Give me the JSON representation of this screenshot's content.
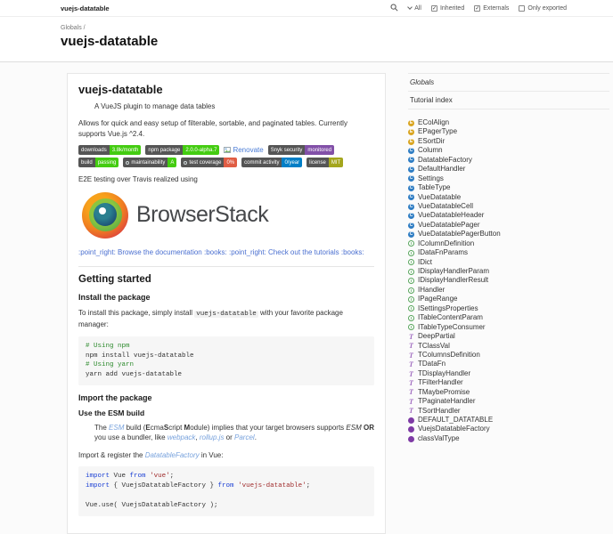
{
  "toolbar": {
    "title": "vuejs-datatable",
    "filter_all": "All",
    "checkboxes": [
      {
        "label": "Inherited",
        "checked": true
      },
      {
        "label": "Externals",
        "checked": true
      },
      {
        "label": "Only exported",
        "checked": false
      }
    ]
  },
  "header": {
    "breadcrumb": "Globals /",
    "title": "vuejs-datatable"
  },
  "content": {
    "title": "vuejs-datatable",
    "tagline": "A VueJS plugin to manage data tables",
    "intro": "Allows for quick and easy setup of filterable, sortable, and paginated tables. Currently supports Vue.js ^2.4.",
    "badges_row1": [
      {
        "label": "downloads",
        "value": "3.8k/month",
        "color": "#44cc11"
      },
      {
        "label": "npm package",
        "value": "2.0.0-alpha.7",
        "color": "#44cc11"
      },
      {
        "special": "renovate",
        "text": "Renovate"
      },
      {
        "label": "Snyk security",
        "value": "monitored",
        "color": "#8250a8"
      },
      {
        "label": "build",
        "value": "passing",
        "color": "#44cc11"
      }
    ],
    "badges_row2": [
      {
        "label": "maintainability",
        "value": "A",
        "color": "#44cc11",
        "icon": true
      },
      {
        "label": "test coverage",
        "value": "0%",
        "color": "#e05d44",
        "icon": true
      },
      {
        "label": "commit activity",
        "value": "0/year",
        "color": "#007ec6"
      },
      {
        "label": "license",
        "value": "MIT",
        "color": "#a4a61d"
      }
    ],
    "e2e_text": "E2E testing over Travis realized using",
    "browserstack_label": "BrowserStack",
    "doc_links": [
      {
        "t": ":point_right: Browse the documentation :books:",
        "s": "link"
      },
      {
        "t": " ",
        "s": "plain"
      },
      {
        "t": ":point_right: Check out the tutorials :books:",
        "s": "link"
      }
    ],
    "getting_started_title": "Getting started",
    "install_title": "Install the package",
    "install_para": [
      {
        "t": "To install this package, simply install ",
        "s": "plain"
      },
      {
        "t": "vuejs-datatable",
        "s": "code"
      },
      {
        "t": " with your favorite package manager:",
        "s": "plain"
      }
    ],
    "install_code": [
      [
        {
          "t": "# Using npm",
          "c": "comment"
        }
      ],
      [
        {
          "t": "npm install vuejs-datatable",
          "c": "plain"
        }
      ],
      [
        {
          "t": "# Using yarn",
          "c": "comment"
        }
      ],
      [
        {
          "t": "yarn add vuejs-datatable",
          "c": "plain"
        }
      ]
    ],
    "import_title": "Import the package",
    "esm_title": "Use the ESM build",
    "esm_note": [
      {
        "t": "The ",
        "s": "plain"
      },
      {
        "t": "ESM",
        "s": "linkem"
      },
      {
        "t": " build (",
        "s": "plain"
      },
      {
        "t": "E",
        "s": "bold"
      },
      {
        "t": "cma",
        "s": "plain"
      },
      {
        "t": "S",
        "s": "bold"
      },
      {
        "t": "cript ",
        "s": "plain"
      },
      {
        "t": "M",
        "s": "bold"
      },
      {
        "t": "odule) implies that your target browsers supports ",
        "s": "plain"
      },
      {
        "t": "ESM",
        "s": "em"
      },
      {
        "t": " ",
        "s": "plain"
      },
      {
        "t": "OR",
        "s": "bold"
      },
      {
        "t": " you use a bundler, like ",
        "s": "plain"
      },
      {
        "t": "webpack",
        "s": "linkem"
      },
      {
        "t": ", ",
        "s": "plain"
      },
      {
        "t": "rollup.js",
        "s": "linkem"
      },
      {
        "t": " or ",
        "s": "plain"
      },
      {
        "t": "Parcel",
        "s": "linkem"
      },
      {
        "t": ".",
        "s": "plain"
      }
    ],
    "register_para": [
      {
        "t": "Import & register the ",
        "s": "plain"
      },
      {
        "t": "DatatableFactory",
        "s": "linkem"
      },
      {
        "t": " in Vue:",
        "s": "plain"
      }
    ],
    "import_code": [
      [
        {
          "t": "import",
          "c": "kw"
        },
        {
          "t": " Vue ",
          "c": "plain"
        },
        {
          "t": "from",
          "c": "kw"
        },
        {
          "t": " ",
          "c": "plain"
        },
        {
          "t": "'vue'",
          "c": "str"
        },
        {
          "t": ";",
          "c": "plain"
        }
      ],
      [
        {
          "t": "import",
          "c": "kw"
        },
        {
          "t": " { VuejsDatatableFactory } ",
          "c": "plain"
        },
        {
          "t": "from",
          "c": "kw"
        },
        {
          "t": " ",
          "c": "plain"
        },
        {
          "t": "'vuejs-datatable'",
          "c": "str"
        },
        {
          "t": ";",
          "c": "plain"
        }
      ],
      [],
      [
        {
          "t": "Vue.use( VuejsDatatableFactory );",
          "c": "plain"
        }
      ]
    ]
  },
  "sidebar": {
    "menu": [
      {
        "label": "Globals",
        "current": true
      },
      {
        "label": "Tutorial index",
        "current": false
      }
    ],
    "symbols": [
      {
        "name": "EColAlign",
        "kind": "enum"
      },
      {
        "name": "EPagerType",
        "kind": "enum"
      },
      {
        "name": "ESortDir",
        "kind": "enum"
      },
      {
        "name": "Column",
        "kind": "class"
      },
      {
        "name": "DatatableFactory",
        "kind": "class"
      },
      {
        "name": "DefaultHandler",
        "kind": "class"
      },
      {
        "name": "Settings",
        "kind": "class"
      },
      {
        "name": "TableType",
        "kind": "class"
      },
      {
        "name": "VueDatatable",
        "kind": "class"
      },
      {
        "name": "VueDatatableCell",
        "kind": "class"
      },
      {
        "name": "VueDatatableHeader",
        "kind": "class"
      },
      {
        "name": "VueDatatablePager",
        "kind": "class"
      },
      {
        "name": "VueDatatablePagerButton",
        "kind": "class"
      },
      {
        "name": "IColumnDefinition",
        "kind": "interface"
      },
      {
        "name": "IDataFnParams",
        "kind": "interface"
      },
      {
        "name": "IDict",
        "kind": "interface"
      },
      {
        "name": "IDisplayHandlerParam",
        "kind": "interface"
      },
      {
        "name": "IDisplayHandlerResult",
        "kind": "interface"
      },
      {
        "name": "IHandler",
        "kind": "interface"
      },
      {
        "name": "IPageRange",
        "kind": "interface"
      },
      {
        "name": "ISettingsProperties",
        "kind": "interface"
      },
      {
        "name": "ITableContentParam",
        "kind": "interface"
      },
      {
        "name": "ITableTypeConsumer",
        "kind": "interface"
      },
      {
        "name": "DeepPartial",
        "kind": "typealias"
      },
      {
        "name": "TClassVal",
        "kind": "typealias"
      },
      {
        "name": "TColumnsDefinition",
        "kind": "typealias"
      },
      {
        "name": "TDataFn",
        "kind": "typealias"
      },
      {
        "name": "TDisplayHandler",
        "kind": "typealias"
      },
      {
        "name": "TFilterHandler",
        "kind": "typealias"
      },
      {
        "name": "TMaybePromise",
        "kind": "typealias"
      },
      {
        "name": "TPaginateHandler",
        "kind": "typealias"
      },
      {
        "name": "TSortHandler",
        "kind": "typealias"
      },
      {
        "name": "DEFAULT_DATATABLE",
        "kind": "variable"
      },
      {
        "name": "VuejsDatatableFactory",
        "kind": "variable"
      },
      {
        "name": "classValType",
        "kind": "variable"
      }
    ],
    "icon_colors": {
      "enum": "#d9a521",
      "class": "#2f7dc3",
      "interface": "#58a55c",
      "typealias": "#a06cc0",
      "variable": "#7e3ba5"
    }
  }
}
